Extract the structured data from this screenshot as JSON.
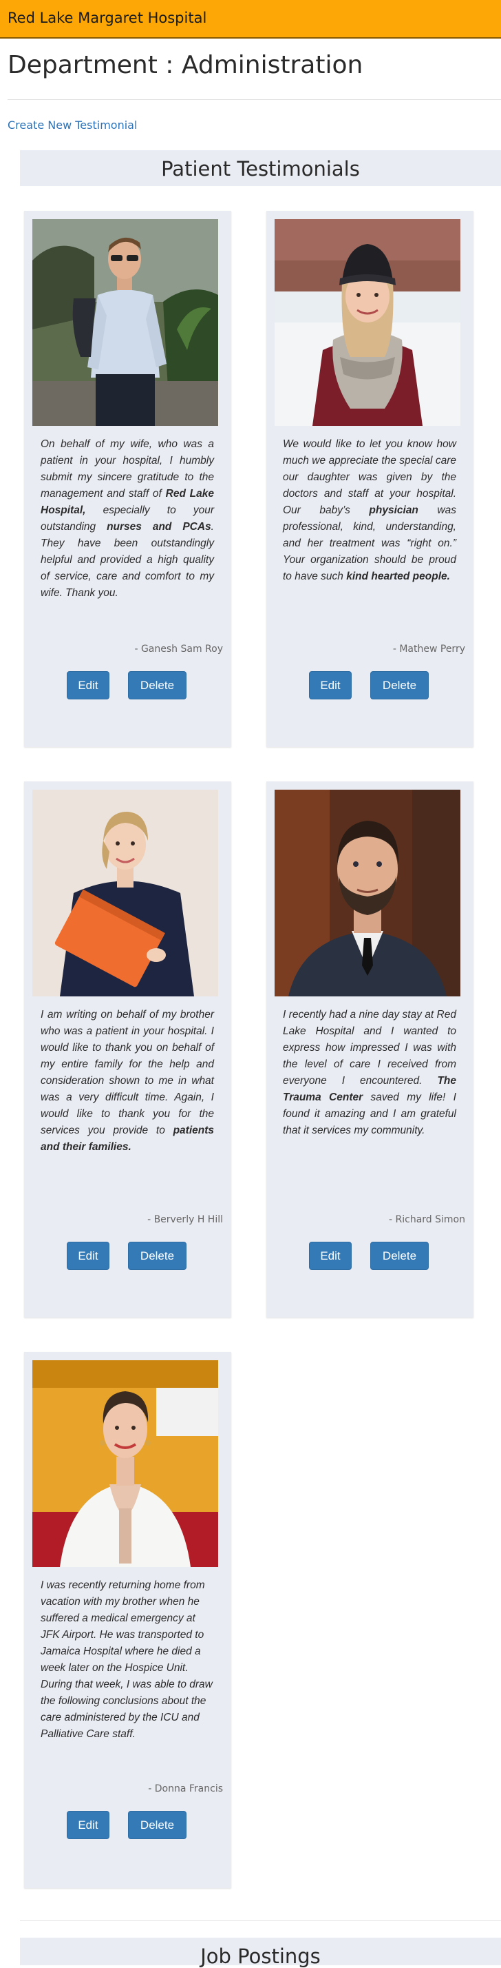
{
  "header": {
    "brand": "Red Lake Margaret Hospital"
  },
  "page": {
    "title": "Department : Administration",
    "create_link": "Create New Testimonial"
  },
  "testimonials_section": {
    "title": "Patient Testimonials",
    "items": [
      {
        "quote_parts": [
          {
            "t": "On behalf of my wife, who was a patient in your hospital, I humbly submit my sincere gratitude to the management and staff of "
          },
          {
            "t": "Red Lake Hospital,",
            "b": true
          },
          {
            "t": " especially to your outstanding "
          },
          {
            "t": "nurses and PCAs",
            "b": true
          },
          {
            "t": ". They have been outstandingly helpful and provided a high quality of service, care and comfort to my wife. Thank you."
          }
        ],
        "author": "- Ganesh Sam Roy",
        "edit_label": "Edit",
        "delete_label": "Delete",
        "photo": "man-in-light-blue-shirt-photo"
      },
      {
        "quote_parts": [
          {
            "t": "We would like to let you know how much we appreciate the special care our daughter was given by the doctors and staff at your hospital. Our baby’s "
          },
          {
            "t": "physician",
            "b": true
          },
          {
            "t": " was professional, kind, understanding, and her treatment was “right on.” Your organization should be proud to have such "
          },
          {
            "t": "kind hearted people.",
            "b": true
          }
        ],
        "author": "- Mathew Perry",
        "edit_label": "Edit",
        "delete_label": "Delete",
        "photo": "woman-in-winter-beanie-photo"
      },
      {
        "quote_parts": [
          {
            "t": "I am writing on behalf of my brother who was a patient in your hospital. I would like to thank you on behalf of my entire family for the help and consideration shown to me in what was a very difficult time. Again, I would like to thank you for the services you provide to "
          },
          {
            "t": "patients and their families.",
            "b": true
          }
        ],
        "author": "- Berverly H Hill",
        "edit_label": "Edit",
        "delete_label": "Delete",
        "photo": "woman-holding-orange-folder-photo"
      },
      {
        "quote_parts": [
          {
            "t": "I recently had a nine day stay at Red Lake Hospital and I wanted to express how impressed I was with the level of care I received from everyone I encountered. "
          },
          {
            "t": "The Trauma Center",
            "b": true
          },
          {
            "t": " saved my life! I found it amazing and I am grateful that it services my community."
          }
        ],
        "author": "- Richard Simon",
        "edit_label": "Edit",
        "delete_label": "Delete",
        "photo": "bearded-man-in-suit-photo"
      },
      {
        "quote_parts": [
          {
            "t": "I was recently returning home from vacation with my brother when he suffered a medical emergency at JFK Airport. He was transported to Jamaica Hospital where he died a week later on the Hospice Unit. During that week, I was able to draw the following conclusions about the care administered by the ICU and Palliative Care staff."
          }
        ],
        "author": "- Donna Francis",
        "edit_label": "Edit",
        "delete_label": "Delete",
        "photo": "woman-in-white-dress-photo"
      }
    ]
  },
  "jobs_section": {
    "title": "Job Postings"
  },
  "colors": {
    "header_bg": "#fca705",
    "card_bg": "#eaecf3",
    "button_bg": "#337ab7",
    "link": "#2f73b7"
  }
}
